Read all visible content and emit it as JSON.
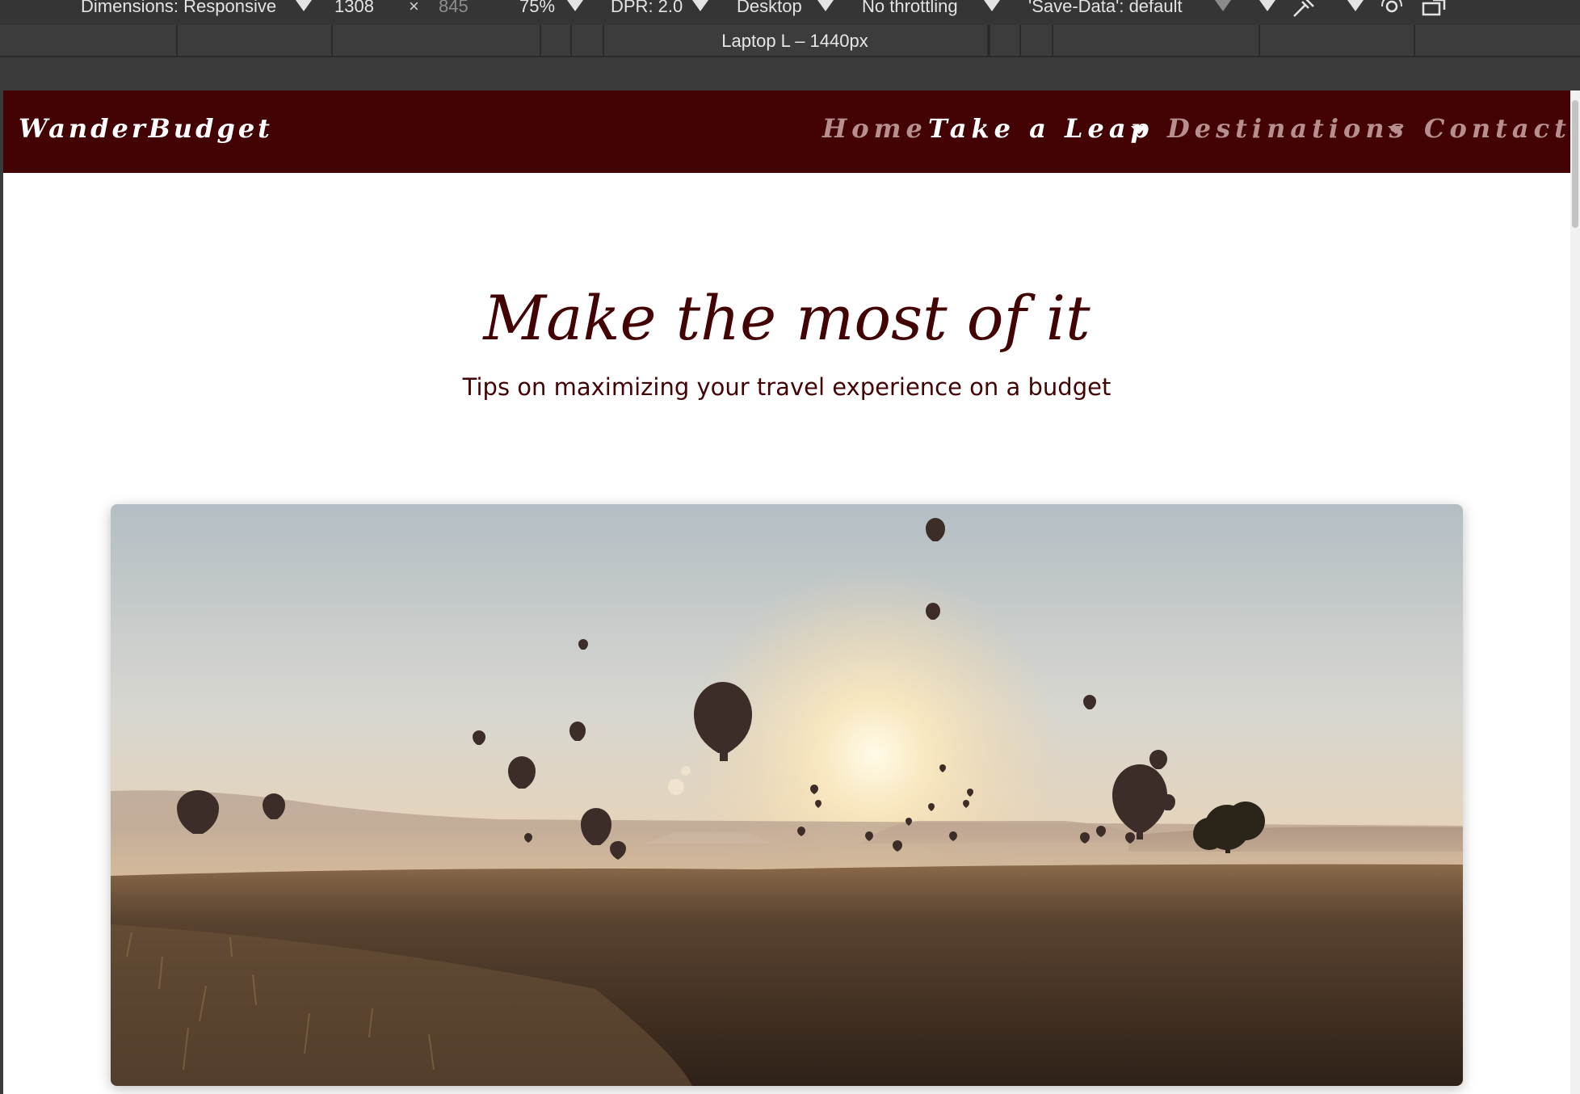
{
  "devtools": {
    "dimensions_label": "Dimensions: Responsive",
    "width_value": "1308",
    "times": "×",
    "height_value": "845",
    "zoom": "75%",
    "dpr": "DPR: 2.0",
    "device": "Desktop",
    "throttling": "No throttling",
    "save_data": "'Save-Data': default",
    "ruler_label": "Laptop L – 1440px",
    "icons": [
      "chevron-down-icon",
      "eyedropper-icon",
      "sensor-icon",
      "rotate-icon"
    ]
  },
  "site": {
    "brand": "WanderBudget",
    "nav": [
      {
        "label": "Home",
        "active": false,
        "dropdown": false
      },
      {
        "label": "Take a Leap",
        "active": true,
        "dropdown": true
      },
      {
        "label": "Destinations",
        "active": false,
        "dropdown": true
      },
      {
        "label": "Contact",
        "active": false,
        "dropdown": false
      }
    ]
  },
  "hero": {
    "title": "Make the most of it",
    "subtitle": "Tips on maximizing your travel experience on a budget"
  },
  "colors": {
    "brand_dark": "#430305",
    "nav_inactive": "#b78f8f",
    "devtools_bg": "#353535"
  }
}
